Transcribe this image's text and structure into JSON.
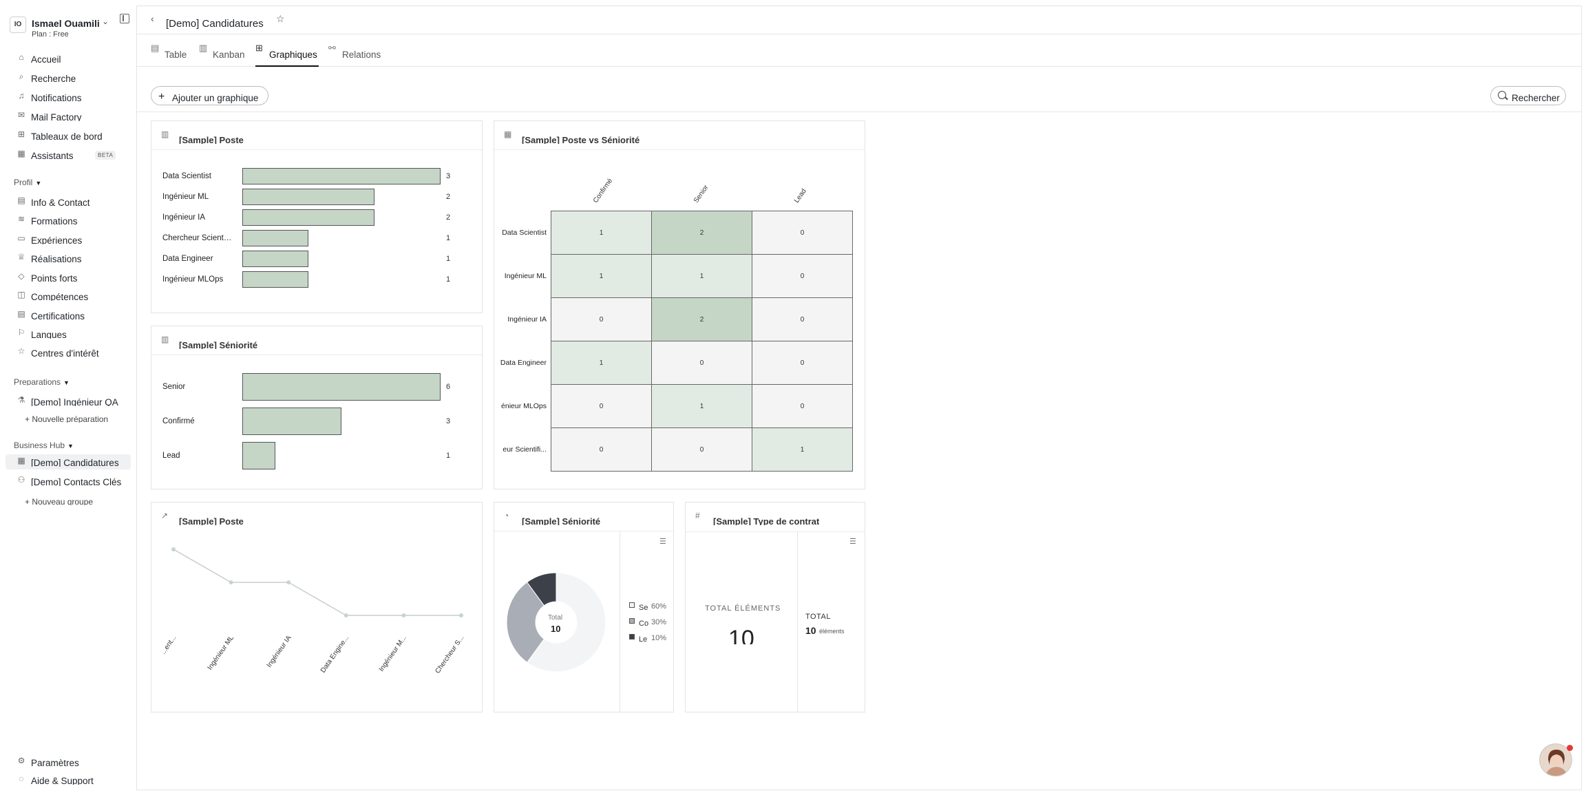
{
  "user": {
    "initials": "IO",
    "name": "Ismael Ouamili",
    "plan": "Plan : Free"
  },
  "nav": [
    {
      "label": "Accueil",
      "icon": "home-icon"
    },
    {
      "label": "Recherche",
      "icon": "search-icon"
    },
    {
      "label": "Notifications",
      "icon": "bell-icon"
    },
    {
      "label": "Mail Factory",
      "icon": "mail-icon"
    },
    {
      "label": "Tableaux de bord",
      "icon": "grid-icon"
    },
    {
      "label": "Assistants",
      "icon": "calendar-icon",
      "badge": "BETA"
    }
  ],
  "profil": {
    "title": "Profil",
    "items": [
      "Info & Contact",
      "Formations",
      "Expériences",
      "Réalisations",
      "Points forts",
      "Compétences",
      "Certifications",
      "Langues",
      "Centres d'intérêt"
    ]
  },
  "preparations": {
    "title": "Preparations",
    "items": [
      "[Demo] Ingénieur QA"
    ],
    "add": "+ Nouvelle préparation"
  },
  "business": {
    "title": "Business Hub",
    "items": [
      "[Demo] Candidatures",
      "[Demo] Contacts Clés"
    ],
    "add": "+ Nouveau groupe"
  },
  "footer": {
    "settings": "Paramètres",
    "help": "Aide & Support"
  },
  "page": {
    "title": "[Demo] Candidatures"
  },
  "tabs": [
    "Table",
    "Kanban",
    "Graphiques",
    "Relations"
  ],
  "toolbar": {
    "add_chart": "Ajouter un graphique",
    "search": "Rechercher"
  },
  "cards": {
    "poste_bar": "[Sample] Poste",
    "poste_heatmap": "[Sample] Poste vs Séniorité",
    "seniorite_bar": "[Sample] Séniorité",
    "poste_line": "[Sample] Poste",
    "seniorite_pie": "[Sample] Séniorité",
    "contract_kpi": "[Sample] Type de contrat"
  },
  "kpi": {
    "label1": "TOTAL ÉLÉMENTS",
    "value1": "10",
    "label2": "TOTAL",
    "value2": "10",
    "unit2": "éléments"
  },
  "donut": {
    "total_label": "Total",
    "total_value": "10"
  },
  "chart_data": [
    {
      "type": "bar",
      "orientation": "horizontal",
      "title": "[Sample] Poste",
      "categories": [
        "Data Scientist",
        "Ingénieur ML",
        "Ingénieur IA",
        "Chercheur Scientif...",
        "Data Engineer",
        "Ingénieur MLOps"
      ],
      "values": [
        3,
        2,
        2,
        1,
        1,
        1
      ],
      "max": 3
    },
    {
      "type": "heatmap",
      "title": "[Sample] Poste vs Séniorité",
      "columns": [
        "Confirmé",
        "Senior",
        "Lead"
      ],
      "rows": [
        "Data Scientist",
        "Ingénieur ML",
        "Ingénieur IA",
        "Data Engineer",
        "énieur MLOps",
        "eur Scientifi..."
      ],
      "values": [
        [
          1,
          2,
          0
        ],
        [
          1,
          1,
          0
        ],
        [
          0,
          2,
          0
        ],
        [
          1,
          0,
          0
        ],
        [
          0,
          1,
          0
        ],
        [
          0,
          0,
          1
        ]
      ]
    },
    {
      "type": "bar",
      "orientation": "horizontal",
      "title": "[Sample] Séniorité",
      "categories": [
        "Senior",
        "Confirmé",
        "Lead"
      ],
      "values": [
        6,
        3,
        1
      ],
      "max": 6
    },
    {
      "type": "line",
      "title": "[Sample] Poste",
      "categories": [
        "...ent...",
        "Ingénieur ML",
        "Ingénieur IA",
        "Data Engine...",
        "Ingénieur M...",
        "Chercheur S..."
      ],
      "values": [
        3,
        2,
        2,
        1,
        1,
        1
      ],
      "ylim": [
        1,
        3
      ]
    },
    {
      "type": "pie",
      "title": "[Sample] Séniorité",
      "series": [
        {
          "name": "Se",
          "value": 60,
          "pct": "60%",
          "color": "#f3f4f6"
        },
        {
          "name": "Co",
          "value": 30,
          "pct": "30%",
          "color": "#a9adb5"
        },
        {
          "name": "Le",
          "value": 10,
          "pct": "10%",
          "color": "#3b4049"
        }
      ]
    }
  ],
  "colors": {
    "bar": "#c5d6c7",
    "hm_high": "#c5d6c7",
    "hm_mid": "#e2ebe3",
    "hm_zero": "#f4f4f5"
  }
}
